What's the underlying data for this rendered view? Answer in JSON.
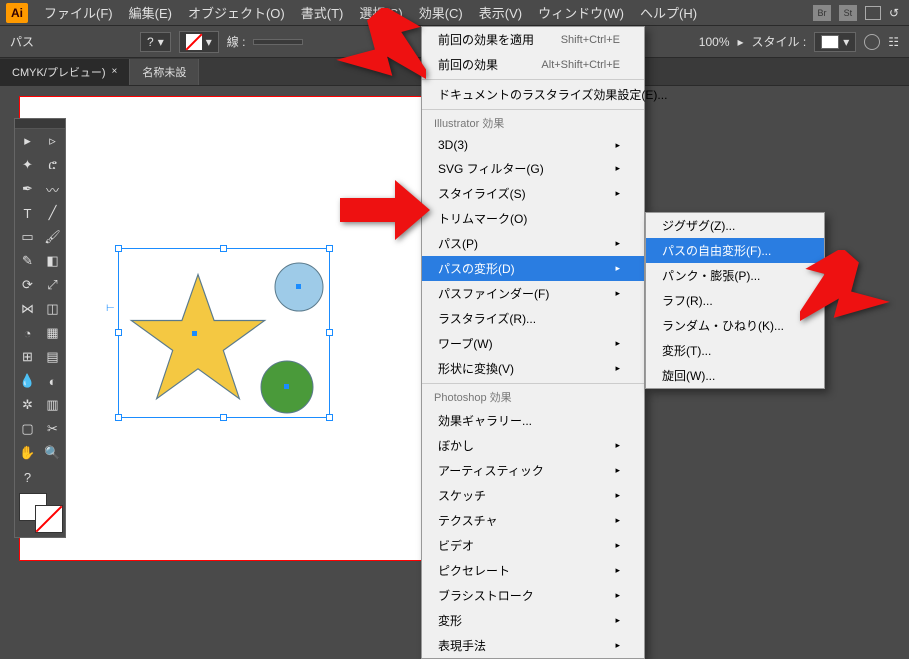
{
  "app": {
    "logo": "Ai"
  },
  "menubar": {
    "items": [
      "ファイル(F)",
      "編集(E)",
      "オブジェクト(O)",
      "書式(T)",
      "選択(S)",
      "効果(C)",
      "表示(V)",
      "ウィンドウ(W)",
      "ヘルプ(H)"
    ],
    "right_icons": [
      "Br",
      "St"
    ]
  },
  "optbar": {
    "label": "パス",
    "stroke_label": "線 :",
    "zoom": "100%",
    "style_label": "スタイル :"
  },
  "tabs": [
    {
      "label": "CMYK/プレビュー)",
      "active": false
    },
    {
      "label": "名称未設",
      "active": true
    }
  ],
  "effect_menu": {
    "apply_last": "前回の効果を適用",
    "apply_last_sc": "Shift+Ctrl+E",
    "last_effect": "前回の効果",
    "last_effect_sc": "Alt+Shift+Ctrl+E",
    "raster_settings": "ドキュメントのラスタライズ効果設定(E)...",
    "section_ai": "Illustrator 効果",
    "items_ai": [
      "3D(3)",
      "SVG フィルター(G)",
      "スタイライズ(S)",
      "トリムマーク(O)",
      "パス(P)",
      "パスの変形(D)",
      "パスファインダー(F)",
      "ラスタライズ(R)...",
      "ワープ(W)",
      "形状に変換(V)"
    ],
    "section_ps": "Photoshop 効果",
    "items_ps": [
      "効果ギャラリー...",
      "ぼかし",
      "アーティスティック",
      "スケッチ",
      "テクスチャ",
      "ビデオ",
      "ピクセレート",
      "ブラシストローク",
      "変形",
      "表現手法"
    ]
  },
  "distort_submenu": {
    "items": [
      "ジグザグ(Z)...",
      "パスの自由変形(F)...",
      "パンク・膨張(P)...",
      "ラフ(R)...",
      "ランダム・ひねり(K)...",
      "変形(T)...",
      "旋回(W)..."
    ]
  },
  "chart_data": null
}
